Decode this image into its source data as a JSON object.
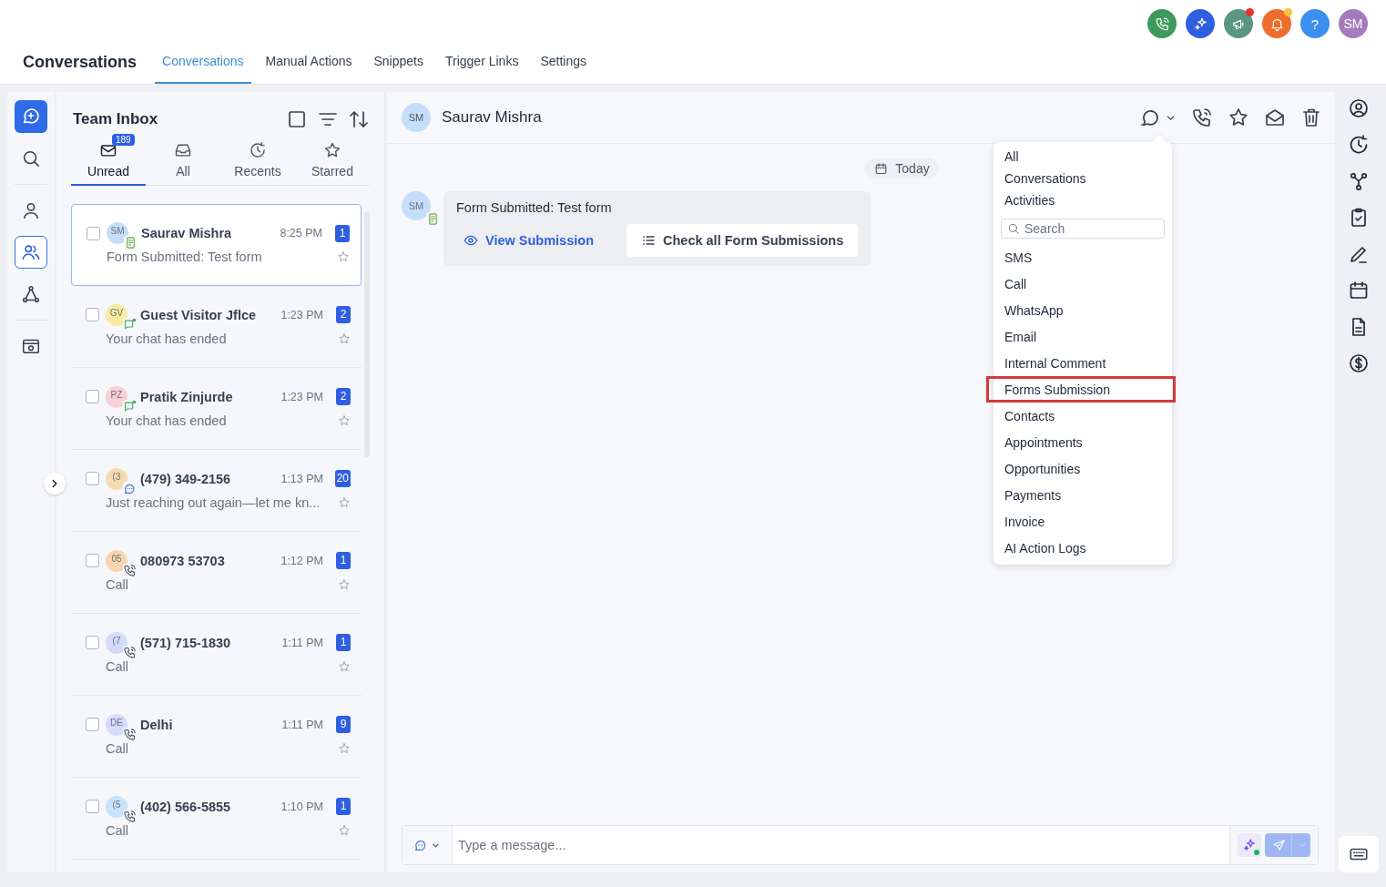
{
  "header": {
    "title": "Conversations",
    "tabs": [
      {
        "label": "Conversations",
        "selected": true
      },
      {
        "label": "Manual Actions",
        "selected": false
      },
      {
        "label": "Snippets",
        "selected": false
      },
      {
        "label": "Trigger Links",
        "selected": false
      },
      {
        "label": "Settings",
        "selected": false
      }
    ]
  },
  "top_actions": {
    "help": "?",
    "avatar": "SM"
  },
  "inbox": {
    "title": "Team Inbox",
    "select_all": {
      "checked": false
    },
    "tabs": [
      {
        "label": "Unread",
        "selected": true,
        "badge": "189"
      },
      {
        "label": "All",
        "selected": false
      },
      {
        "label": "Recents",
        "selected": false
      },
      {
        "label": "Starred",
        "selected": false
      }
    ],
    "conversations": [
      {
        "initials": "SM",
        "color": "#c5dffb",
        "kind": "form",
        "name": "Saurav Mishra",
        "time": "8:25 PM",
        "count": "1",
        "preview": "Form Submitted: Test form",
        "selected": true,
        "checked": false
      },
      {
        "initials": "GV",
        "color": "#f9eaa0",
        "kind": "chat",
        "name": "Guest Visitor Jflce",
        "time": "1:23 PM",
        "count": "2",
        "preview": "Your chat has ended",
        "selected": false,
        "checked": false
      },
      {
        "initials": "PZ",
        "color": "#f8d0d6",
        "kind": "chat",
        "name": "Pratik Zinjurde",
        "time": "1:23 PM",
        "count": "2",
        "preview": "Your chat has ended",
        "selected": false,
        "checked": false
      },
      {
        "initials": "(3",
        "color": "#f5dcae",
        "kind": "sms",
        "name": "(479) 349-2156",
        "time": "1:13 PM",
        "count": "20",
        "preview": "Just reaching out again—let me kn...",
        "selected": false,
        "checked": false
      },
      {
        "initials": "05",
        "color": "#f8d6ad",
        "kind": "call",
        "name": "080973 53703",
        "time": "1:12 PM",
        "count": "1",
        "preview": "Call",
        "selected": false,
        "checked": false
      },
      {
        "initials": "(7",
        "color": "#d5dcfb",
        "kind": "call",
        "name": "(571) 715-1830",
        "time": "1:11 PM",
        "count": "1",
        "preview": "Call",
        "selected": false,
        "checked": false
      },
      {
        "initials": "DE",
        "color": "#d5dcfb",
        "kind": "call",
        "name": "Delhi",
        "time": "1:11 PM",
        "count": "9",
        "preview": "Call",
        "selected": false,
        "checked": false
      },
      {
        "initials": "(5",
        "color": "#c9e3fb",
        "kind": "call",
        "name": "(402) 566-5855",
        "time": "1:10 PM",
        "count": "1",
        "preview": "Call",
        "selected": false,
        "checked": false
      }
    ]
  },
  "chat": {
    "contact": {
      "initials": "SM",
      "name": "Saurav Mishra"
    },
    "date": "Today",
    "message": {
      "initials": "SM",
      "text": "Form Submitted: Test form",
      "actions": [
        "View Submission",
        "Check all Form Submissions"
      ]
    },
    "composer": {
      "placeholder": "Type a message..."
    }
  },
  "filter_menu": {
    "header": "All Conversations Activities",
    "search_placeholder": "Search",
    "items": [
      {
        "label": "SMS",
        "highlighted": false
      },
      {
        "label": "Call",
        "highlighted": false
      },
      {
        "label": "WhatsApp",
        "highlighted": false
      },
      {
        "label": "Email",
        "highlighted": false
      },
      {
        "label": "Internal Comment",
        "highlighted": false
      },
      {
        "label": "Forms Submission",
        "highlighted": true
      },
      {
        "label": "Contacts",
        "highlighted": false
      },
      {
        "label": "Appointments",
        "highlighted": false
      },
      {
        "label": "Opportunities",
        "highlighted": false
      },
      {
        "label": "Payments",
        "highlighted": false
      },
      {
        "label": "Invoice",
        "highlighted": false
      },
      {
        "label": "AI Action Logs",
        "highlighted": false
      }
    ]
  }
}
